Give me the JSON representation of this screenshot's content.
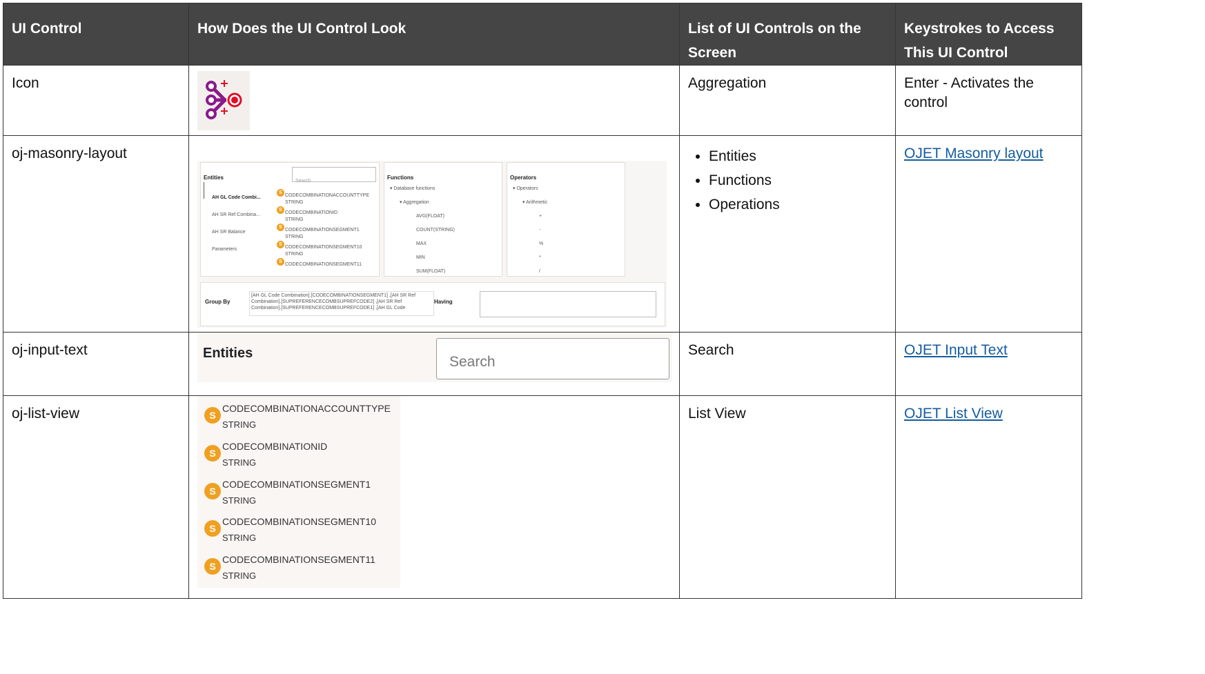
{
  "header": {
    "col1": "UI Control",
    "col2": "How Does the UI Control Look",
    "col3": "List of UI Controls on the Screen",
    "col4": "Keystrokes to Access This UI Control"
  },
  "rows": [
    {
      "control": "Icon",
      "list_text": "Aggregation",
      "keystrokes": "Enter - Activates the control",
      "icon_name": "aggregation-icon"
    },
    {
      "control": "oj-masonry-layout",
      "list_items": [
        "Entities",
        "Functions",
        "Operations"
      ],
      "link": "OJET Masonry layout",
      "sample": {
        "entities": {
          "title": "Entities",
          "search_placeholder": "Search",
          "tabs": [
            "AH GL Code Combi...",
            "AH SR Ref Combina...",
            "AH SR Balance",
            "Parameters"
          ],
          "items": [
            {
              "name": "CODECOMBINATIONACCOUNTTYPE",
              "type": "STRING"
            },
            {
              "name": "CODECOMBINATIONID",
              "type": "STRING"
            },
            {
              "name": "CODECOMBINATIONSEGMENT1",
              "type": "STRING"
            },
            {
              "name": "CODECOMBINATIONSEGMENT10",
              "type": "STRING"
            },
            {
              "name": "CODECOMBINATIONSEGMENT11",
              "type": ""
            }
          ]
        },
        "functions": {
          "title": "Functions",
          "nodes": [
            "Database functions",
            "Aggregation",
            "AVG(FLOAT)",
            "COUNT(STRING)",
            "MAX",
            "MIN",
            "SUM(FLOAT)"
          ]
        },
        "operators": {
          "title": "Operators",
          "nodes": [
            "Operators",
            "Arithmetic",
            "+",
            "-",
            "%",
            "*",
            "/"
          ]
        },
        "group_by": {
          "label": "Group By",
          "text": "[AH GL Code Combination].[CODECOMBINATIONSEGMENT1] ,[AH SR Ref Combination].[SUPREFERENCECOMBSUPREFCODE2] ,[AH SR Ref Combination].[SUPREFERENCECOMBSUPREFCODE1] ,[AH GL Code",
          "having_label": "Having"
        }
      }
    },
    {
      "control": "oj-input-text",
      "list_text": "Search",
      "link": "OJET Input Text",
      "sample": {
        "title": "Entities",
        "search_placeholder": "Search"
      }
    },
    {
      "control": "oj-list-view",
      "list_text": "List View",
      "link": "OJET List View",
      "sample": {
        "badge": "S",
        "items": [
          {
            "name": "CODECOMBINATIONACCOUNTTYPE",
            "type": "STRING"
          },
          {
            "name": "CODECOMBINATIONID",
            "type": "STRING"
          },
          {
            "name": "CODECOMBINATIONSEGMENT1",
            "type": "STRING"
          },
          {
            "name": "CODECOMBINATIONSEGMENT10",
            "type": "STRING"
          },
          {
            "name": "CODECOMBINATIONSEGMENT11",
            "type": "STRING"
          }
        ]
      }
    }
  ],
  "colors": {
    "header_bg": "#454545",
    "link": "#145c9e",
    "badge": "#f0a020",
    "icon_purple": "#8a1a8a",
    "icon_red": "#e0102a"
  }
}
